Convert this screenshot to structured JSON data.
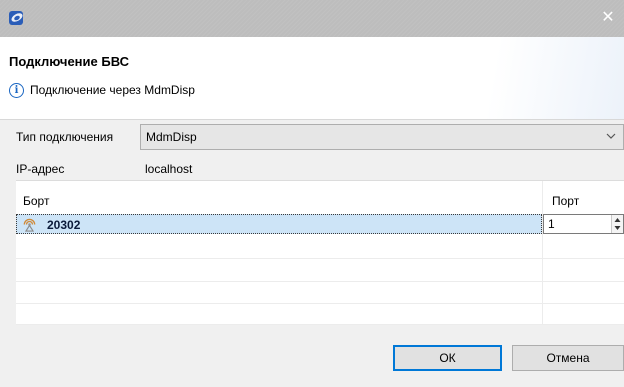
{
  "window": {
    "icon": "app-icon",
    "close_icon": "close-icon"
  },
  "header": {
    "title": "Подключение БВС",
    "info_icon": "info-icon",
    "message": "Подключение через MdmDisp"
  },
  "form": {
    "connection_type_label": "Тип подключения",
    "connection_type_value": "MdmDisp",
    "ip_label": "IP-адрес",
    "ip_value": "localhost"
  },
  "table": {
    "columns": [
      "Борт",
      "Порт"
    ],
    "rows": [
      {
        "icon": "aircraft-signal-icon",
        "bort": "20302",
        "port": "1",
        "selected": true
      }
    ]
  },
  "buttons": {
    "ok": "ОК",
    "cancel": "Отмена"
  },
  "colors": {
    "accent": "#0078d7",
    "selection": "#cde4f7",
    "info": "#1a66c2"
  }
}
